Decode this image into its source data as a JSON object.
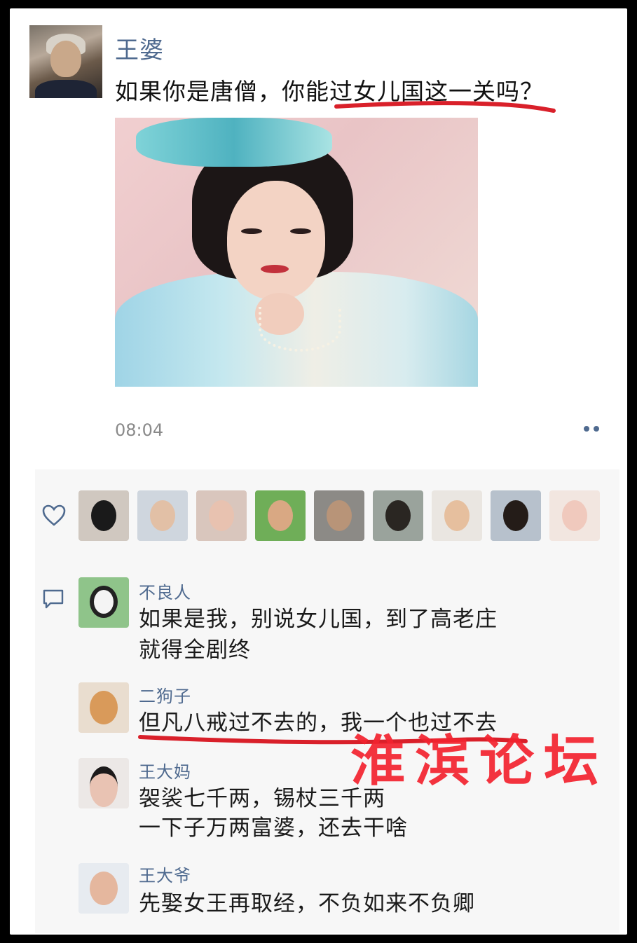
{
  "post": {
    "author": "王婆",
    "text": "如果你是唐僧，你能过女儿国这一关吗？",
    "time": "08:04"
  },
  "likes": {
    "icon": "heart-outline-icon",
    "avatars": [
      "liker-1",
      "liker-2",
      "liker-3",
      "liker-4",
      "liker-5",
      "liker-6",
      "liker-7",
      "liker-8",
      "liker-9"
    ]
  },
  "comments": [
    {
      "name": "不良人",
      "lines": [
        "如果是我，别说女儿国，到了高老庄",
        "就得全剧终"
      ]
    },
    {
      "name": "二狗子",
      "lines": [
        "但凡八戒过不去的，我一个也过不去"
      ]
    },
    {
      "name": "王大妈",
      "lines": [
        "袈裟七千两，锡杖三千两",
        "一下子万两富婆，还去干啥"
      ]
    },
    {
      "name": "王大爷",
      "lines": [
        "先娶女王再取经，不负如来不负卿"
      ]
    }
  ],
  "watermark": "淮滨论坛",
  "colors": {
    "name_blue": "#4f6a8f",
    "underline_red": "#d9202a",
    "watermark_red": "#f3232f",
    "panel_bg": "#f7f7f7"
  }
}
